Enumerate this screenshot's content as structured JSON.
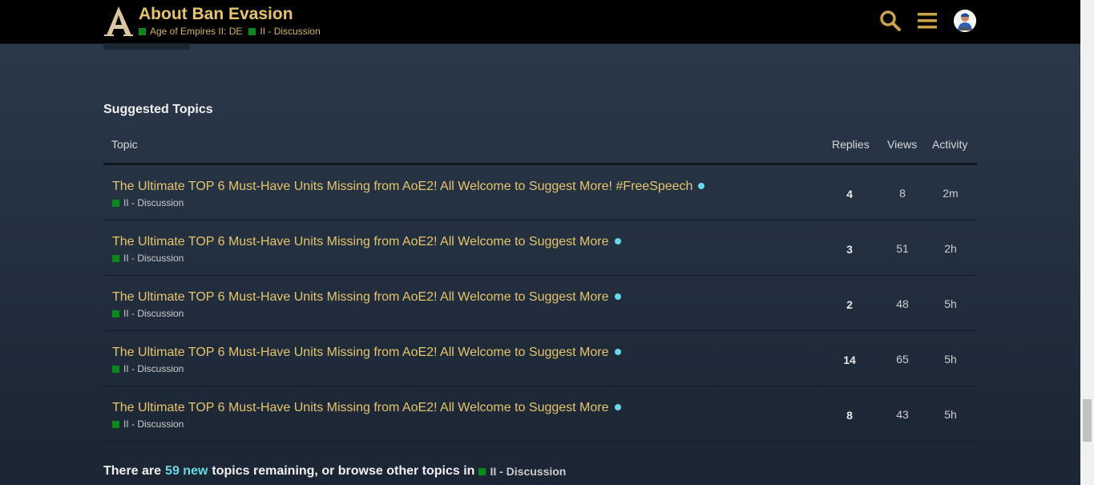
{
  "header": {
    "title": "About Ban Evasion",
    "breadcrumbs": [
      {
        "label": "Age of Empires II: DE",
        "color": "#0a8a1a"
      },
      {
        "label": "II - Discussion",
        "color": "#0a8a1a"
      }
    ],
    "icons": [
      "search-icon",
      "hamburger-menu-icon",
      "user-avatar"
    ]
  },
  "suggested": {
    "title": "Suggested Topics",
    "columns": {
      "topic": "Topic",
      "replies": "Replies",
      "views": "Views",
      "activity": "Activity"
    },
    "rows": [
      {
        "title": "The Ultimate TOP 6 Must-Have Units Missing from AoE2! All Welcome to Suggest More! #FreeSpeech",
        "category": "II - Discussion",
        "replies": "4",
        "views": "8",
        "activity": "2m"
      },
      {
        "title": "The Ultimate TOP 6 Must-Have Units Missing from AoE2! All Welcome to Suggest More",
        "category": "II - Discussion",
        "replies": "3",
        "views": "51",
        "activity": "2h"
      },
      {
        "title": "The Ultimate TOP 6 Must-Have Units Missing from AoE2! All Welcome to Suggest More",
        "category": "II - Discussion",
        "replies": "2",
        "views": "48",
        "activity": "5h"
      },
      {
        "title": "The Ultimate TOP 6 Must-Have Units Missing from AoE2! All Welcome to Suggest More",
        "category": "II - Discussion",
        "replies": "14",
        "views": "65",
        "activity": "5h"
      },
      {
        "title": "The Ultimate TOP 6 Must-Have Units Missing from AoE2! All Welcome to Suggest More",
        "category": "II - Discussion",
        "replies": "8",
        "views": "43",
        "activity": "5h"
      }
    ]
  },
  "footer": {
    "prefix": "There are",
    "new_count": "59 new",
    "middle": "topics remaining, or browse other topics in",
    "category": "II - Discussion"
  },
  "colors": {
    "accent": "#e6c46b",
    "category": "#0a8a1a",
    "new_dot": "#66d9e6"
  }
}
